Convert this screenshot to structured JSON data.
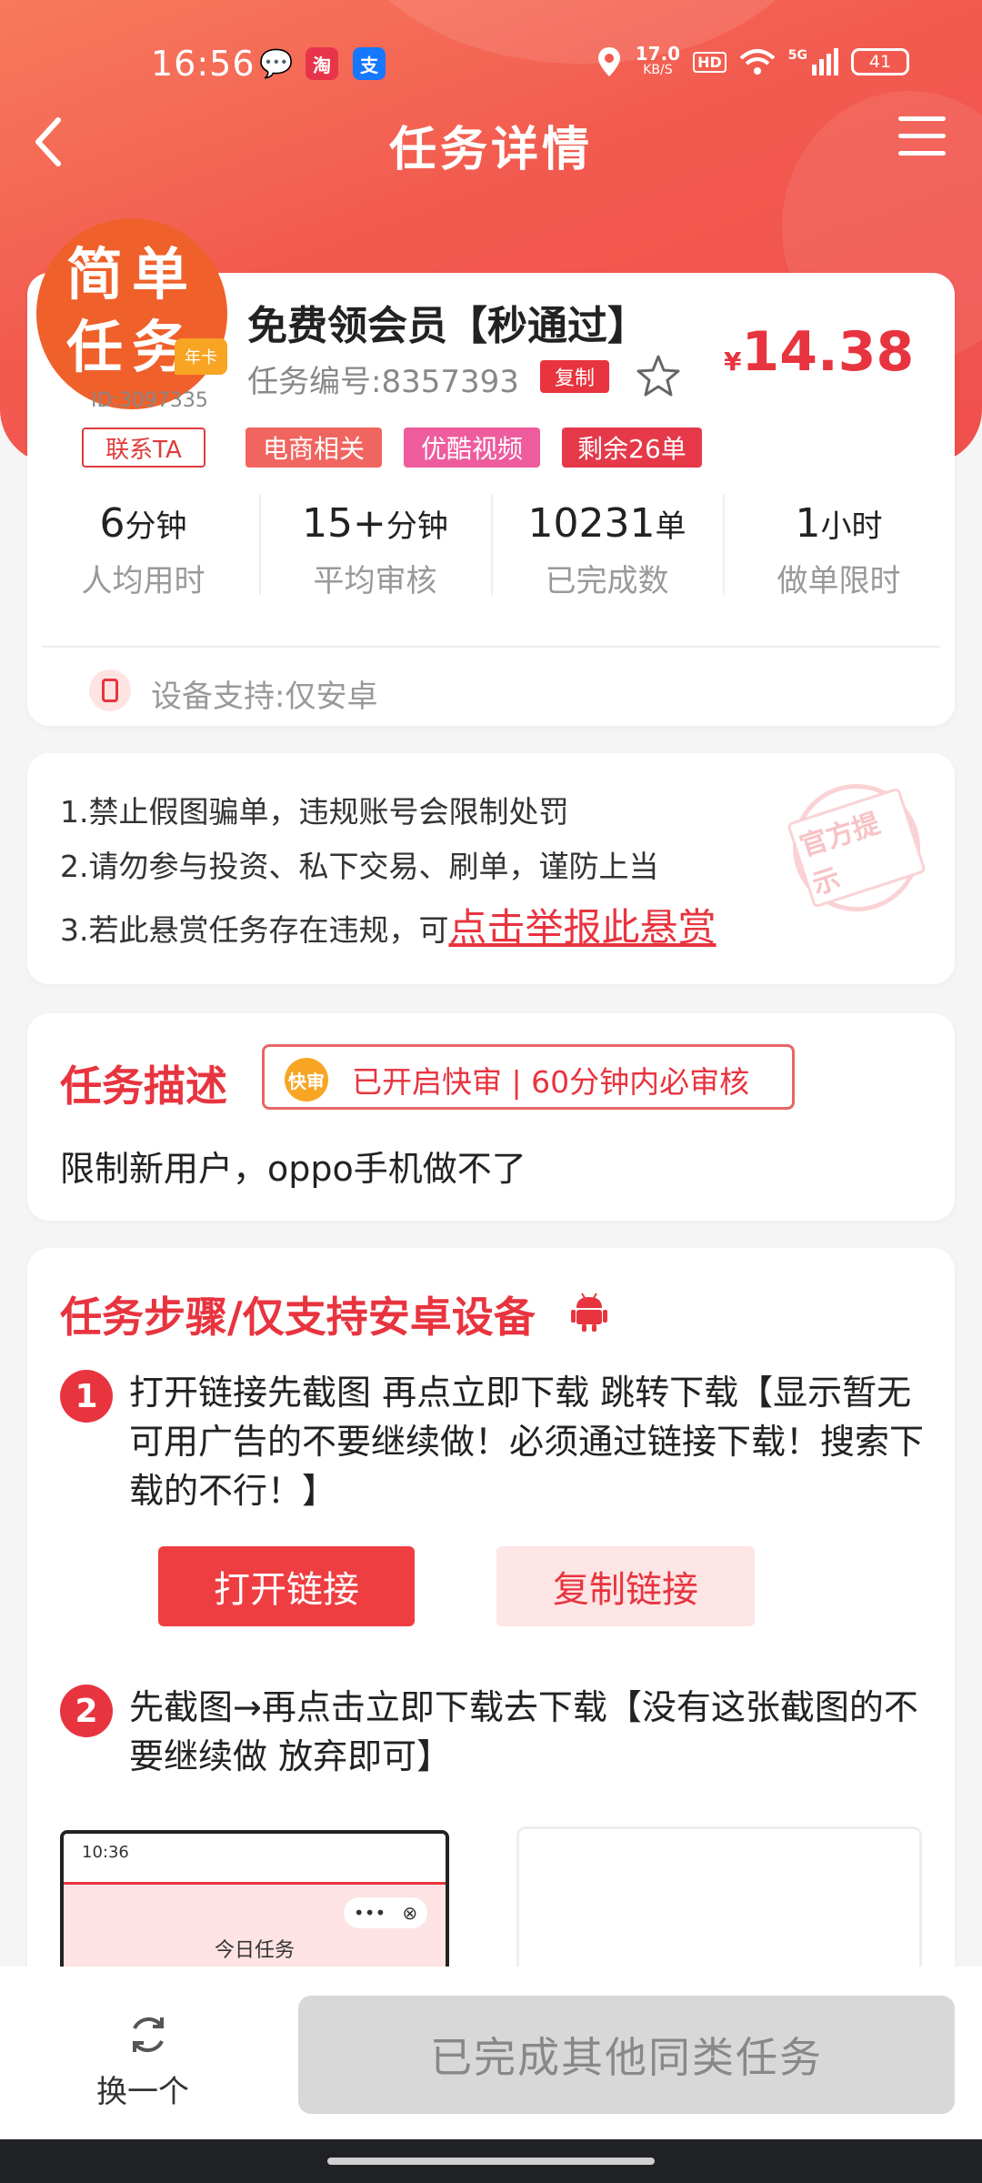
{
  "status_bar": {
    "time": "16:56",
    "net_speed_top": "17.0",
    "net_speed_unit": "KB/S",
    "hd": "HD",
    "network": "5G",
    "battery": "41",
    "apps": [
      "wechat-icon",
      "taobao-icon",
      "alipay-icon"
    ]
  },
  "nav": {
    "title": "任务详情"
  },
  "task": {
    "badge_line1": "简单",
    "badge_line2": "任务",
    "badge_tag": "年卡",
    "user_id": "ID:3097335",
    "contact_label": "联系TA",
    "title": "免费领会员【秒通过】",
    "task_no": "任务编号:8357393",
    "copy_label": "复制",
    "price_symbol": "¥",
    "price": "14.38",
    "tags": [
      {
        "label": "电商相关",
        "color": "#f0655f"
      },
      {
        "label": "优酷视频",
        "color": "#ee5c9d"
      },
      {
        "label": "剩余26单",
        "color": "#e5394a"
      }
    ],
    "stats": [
      {
        "value": "6",
        "unit": "分钟",
        "label": "人均用时"
      },
      {
        "value": "15+",
        "unit": "分钟",
        "label": "平均审核"
      },
      {
        "value": "10231",
        "unit": "单",
        "label": "已完成数"
      },
      {
        "value": "1",
        "unit": "小时",
        "label": "做单限时"
      }
    ],
    "device_support": "设备支持:仅安卓"
  },
  "notice": {
    "line1": "1.禁止假图骗单，违规账号会限制处罚",
    "line2": "2.请勿参与投资、私下交易、刷单，谨防上当",
    "line3_prefix": "3.若此悬赏任务存在违规，可",
    "report_link": "点击举报此悬赏",
    "stamp": "官方提示"
  },
  "description": {
    "title": "任务描述",
    "fast_icon": "快审",
    "fast_text": "已开启快审 | 60分钟内必审核",
    "text": "限制新用户，oppo手机做不了"
  },
  "steps": {
    "title": "任务步骤/仅支持安卓设备",
    "step1_num": "1",
    "step1_text": "打开链接先截图 再点立即下载 跳转下载【显示暂无可用广告的不要继续做！必须通过链接下载！搜索下载的不行！】",
    "open_link": "打开链接",
    "copy_link": "复制链接",
    "step2_num": "2",
    "step2_text": "先截图→再点击立即下载去下载【没有这张截图的不要继续做 放弃即可】",
    "shot_time": "10:36",
    "shot_title": "今日任务"
  },
  "bottom": {
    "swap_label": "换一个",
    "done_label": "已完成其他同类任务"
  },
  "colors": {
    "primary_red": "#e8343f",
    "header_gradient_start": "#f77a5d",
    "header_gradient_end": "#f0504d",
    "disabled_gray": "#d8d8d8"
  }
}
